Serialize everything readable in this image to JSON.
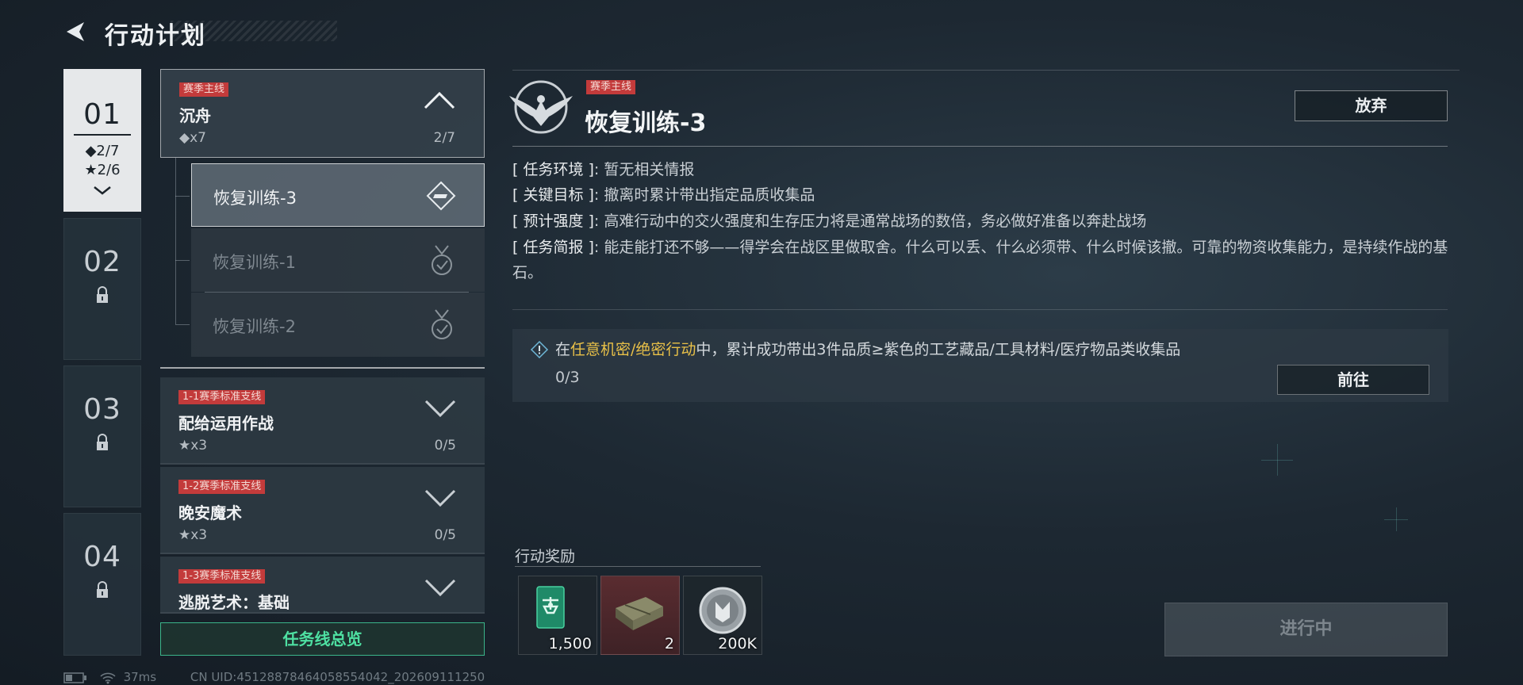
{
  "header": {
    "title": "行动计划"
  },
  "chapters": [
    {
      "number": "01",
      "diamond_progress": "◆2/7",
      "star_progress": "★2/6",
      "icon": "chevron-down-icon"
    },
    {
      "number": "02",
      "icon": "lock-icon"
    },
    {
      "number": "03",
      "icon": "lock-icon"
    },
    {
      "number": "04",
      "icon": "lock-icon"
    }
  ],
  "main_mission": {
    "tag": "赛季主线",
    "title": "沉舟",
    "reward": "◆x7",
    "count": "2/7",
    "icon": "chevron-up-icon"
  },
  "sub_missions": [
    {
      "label": "恢复训练-3",
      "icon": "diamond-badge-icon",
      "state": "active"
    },
    {
      "label": "恢复训练-1",
      "icon": "medal-check-icon",
      "state": "done"
    },
    {
      "label": "恢复训练-2",
      "icon": "medal-check-icon",
      "state": "done"
    }
  ],
  "side_missions": [
    {
      "tag": "1-1赛季标准支线",
      "title": "配给运用作战",
      "reward": "★x3",
      "count": "0/5"
    },
    {
      "tag": "1-2赛季标准支线",
      "title": "晚安魔术",
      "reward": "★x3",
      "count": "0/5"
    },
    {
      "tag": "1-3赛季标准支线",
      "title": "逃脱艺术：基础"
    }
  ],
  "overview_button": "任务线总览",
  "detail": {
    "emblem": "eagle-emblem-icon",
    "tag": "赛季主线",
    "title": "恢复训练-3",
    "abandon_button": "放弃",
    "info": [
      {
        "key": "[ 任务环境 ]",
        "value": ": 暂无相关情报"
      },
      {
        "key": "[ 关键目标 ]",
        "value": ": 撤离时累计带出指定品质收集品"
      },
      {
        "key": "[ 预计强度 ]",
        "value": ": 高难行动中的交火强度和生存压力将是通常战场的数倍，务必做好准备以奔赴战场"
      },
      {
        "key": "[ 任务简报 ]",
        "value": ": 能走能打还不够——得学会在战区里做取舍。什么可以丢、什么必须带、什么时候该撤。可靠的物资收集能力，是持续作战的基石。"
      }
    ],
    "objective": {
      "prefix": "在",
      "highlight": "任意机密/绝密行动",
      "suffix": "中，累计成功带出3件品质≥紫色的工艺藏品/工具材料/医疗物品类收集品",
      "progress": "0/3",
      "go_button": "前往"
    },
    "reward_label": "行动奖励",
    "rewards": [
      {
        "icon": "drone-card-icon",
        "qty": "1,500"
      },
      {
        "icon": "ammo-crate-icon",
        "qty": "2"
      },
      {
        "icon": "silver-coin-icon",
        "qty": "200K"
      }
    ],
    "status_button": "进行中"
  },
  "status_bar": {
    "ping": "37ms",
    "uid": "CN UID:45128878464058554042_202609111250"
  },
  "colors": {
    "accent_green": "#4ee0a2",
    "tag_red": "#c33b3b",
    "highlight_gold": "#e8c048"
  }
}
